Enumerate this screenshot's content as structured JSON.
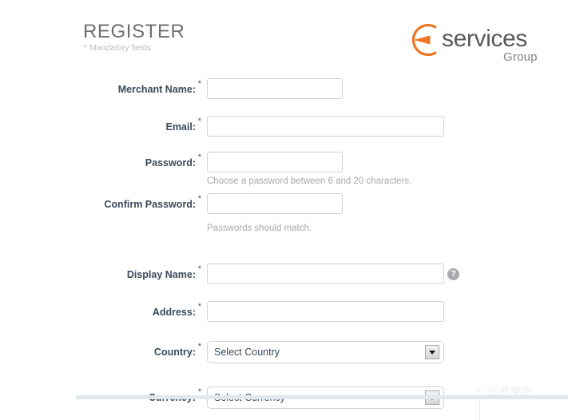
{
  "header": {
    "title": "REGISTER",
    "mandatory_note": "* Mandatory fields"
  },
  "logo": {
    "mark_icon": "orange-ring-wedge-icon",
    "word": "services",
    "sub": "Group",
    "accent_color": "#ec7723",
    "word_color": "#58595b"
  },
  "form": {
    "required_marker": "*",
    "fields": [
      {
        "name": "merchant-name",
        "label": "Merchant Name:",
        "value": "",
        "placeholder": "",
        "required": true,
        "hint": ""
      },
      {
        "name": "email",
        "label": "Email:",
        "value": "",
        "placeholder": "",
        "required": true,
        "hint": ""
      },
      {
        "name": "password",
        "label": "Password:",
        "value": "",
        "placeholder": "",
        "required": true,
        "hint": "Choose a password between 6 and 20 characters."
      },
      {
        "name": "confirm-password",
        "label": "Confirm Password:",
        "value": "",
        "placeholder": "",
        "required": true,
        "hint": "Passwords should match."
      },
      {
        "name": "display-name",
        "label": "Display Name:",
        "value": "",
        "placeholder": "",
        "required": true,
        "hint": "",
        "help_icon": "question-mark-icon"
      },
      {
        "name": "address",
        "label": "Address:",
        "value": "",
        "placeholder": "",
        "required": true,
        "hint": ""
      }
    ],
    "selects": [
      {
        "name": "country",
        "label": "Country:",
        "selected": "Select Country",
        "required": true,
        "arrow_icon": "chevron-down-icon"
      },
      {
        "name": "currency",
        "label": "Currency:",
        "selected": "Select Currency",
        "required": true,
        "arrow_icon": "chevron-down-icon"
      }
    ]
  },
  "watermark": {
    "text": "三月梦呓",
    "icon": "wechat-logo-icon"
  }
}
